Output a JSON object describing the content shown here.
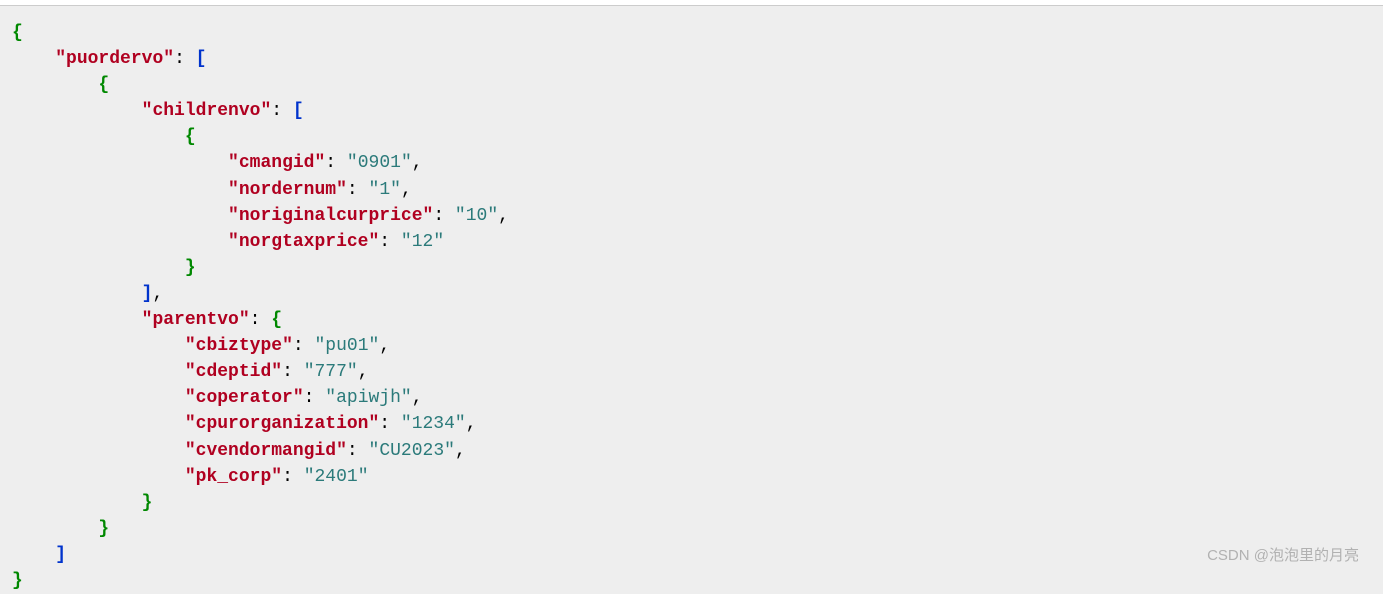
{
  "json": {
    "root_key": "puordervo",
    "array_item": {
      "childrenvo_key": "childrenvo",
      "children": [
        {
          "cmangid_key": "cmangid",
          "cmangid_val": "0901",
          "nordernum_key": "nordernum",
          "nordernum_val": "1",
          "noriginalcurprice_key": "noriginalcurprice",
          "noriginalcurprice_val": "10",
          "norgtaxprice_key": "norgtaxprice",
          "norgtaxprice_val": "12"
        }
      ],
      "parentvo_key": "parentvo",
      "parentvo": {
        "cbiztype_key": "cbiztype",
        "cbiztype_val": "pu01",
        "cdeptid_key": "cdeptid",
        "cdeptid_val": "777",
        "coperator_key": "coperator",
        "coperator_val": "apiwjh",
        "cpurorganization_key": "cpurorganization",
        "cpurorganization_val": "1234",
        "cvendormangid_key": "cvendormangid",
        "cvendormangid_val": "CU2023",
        "pk_corp_key": "pk_corp",
        "pk_corp_val": "2401"
      }
    }
  },
  "watermark": "CSDN @泡泡里的月亮"
}
